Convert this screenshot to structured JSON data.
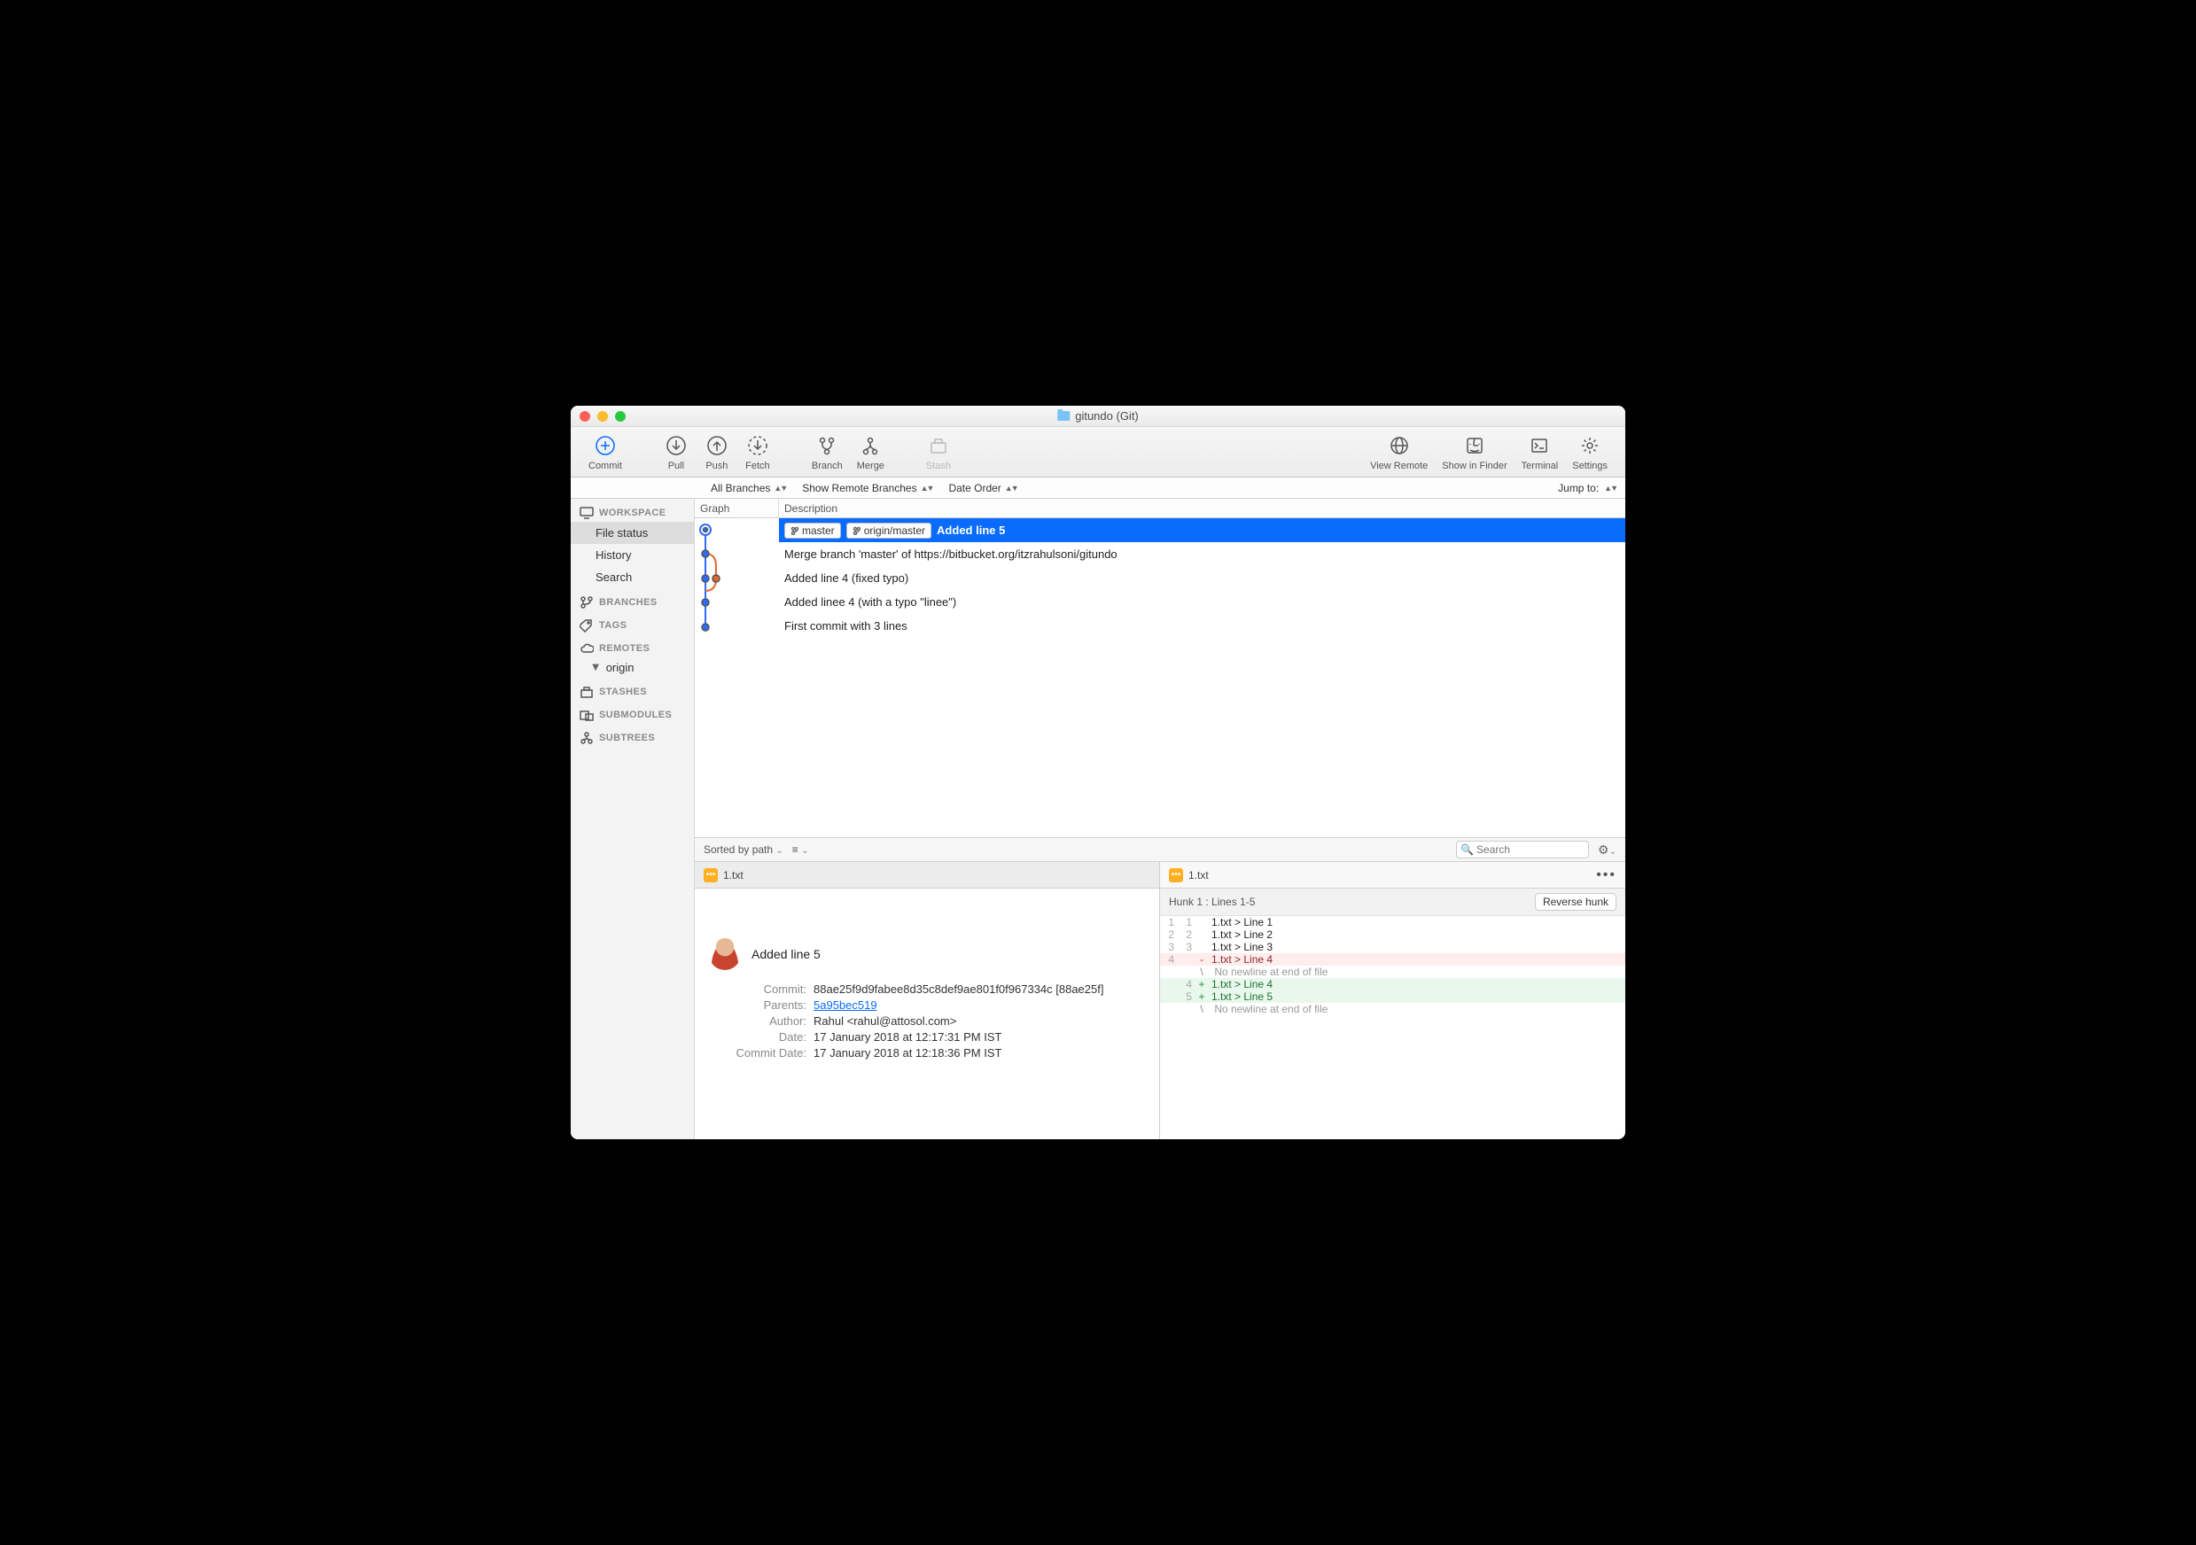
{
  "title": "gitundo (Git)",
  "toolbar": {
    "commit": "Commit",
    "pull": "Pull",
    "push": "Push",
    "fetch": "Fetch",
    "branch": "Branch",
    "merge": "Merge",
    "stash": "Stash",
    "view_remote": "View Remote",
    "show_in_finder": "Show in Finder",
    "terminal": "Terminal",
    "settings": "Settings"
  },
  "filter": {
    "branches": "All Branches",
    "remote": "Show Remote Branches",
    "order": "Date Order",
    "jump_label": "Jump to:"
  },
  "columns": {
    "graph": "Graph",
    "description": "Description"
  },
  "sidebar": {
    "workspace": "WORKSPACE",
    "file_status": "File status",
    "history": "History",
    "search": "Search",
    "branches": "BRANCHES",
    "tags": "TAGS",
    "remotes": "REMOTES",
    "origin": "origin",
    "stashes": "STASHES",
    "submodules": "SUBMODULES",
    "subtrees": "SUBTREES"
  },
  "commits": [
    {
      "tags": [
        "master",
        "origin/master"
      ],
      "msg": "Added line 5",
      "selected": true
    },
    {
      "tags": [],
      "msg": "Merge branch 'master' of https://bitbucket.org/itzrahulsoni/gitundo"
    },
    {
      "tags": [],
      "msg": "Added line 4 (fixed typo)"
    },
    {
      "tags": [],
      "msg": "Added linee 4 (with a typo \"linee\")"
    },
    {
      "tags": [],
      "msg": "First commit with 3 lines"
    }
  ],
  "pathbar": {
    "sort": "Sorted by path",
    "search_placeholder": "Search"
  },
  "file": {
    "name": "1.txt"
  },
  "detail": {
    "title": "Added line 5",
    "commit_label": "Commit:",
    "commit": "88ae25f9d9fabee8d35c8def9ae801f0f967334c [88ae25f]",
    "parents_label": "Parents:",
    "parents": "5a95bec519",
    "author_label": "Author:",
    "author": "Rahul <rahul@attosol.com>",
    "date_label": "Date:",
    "date": "17 January 2018 at 12:17:31 PM IST",
    "commit_date_label": "Commit Date:",
    "commit_date": "17 January 2018 at 12:18:36 PM IST"
  },
  "hunk": {
    "header": "Hunk 1 : Lines 1-5",
    "reverse": "Reverse hunk",
    "lines": [
      {
        "a": "1",
        "b": "1",
        "g": " ",
        "t": "1.txt > Line 1",
        "cls": ""
      },
      {
        "a": "2",
        "b": "2",
        "g": " ",
        "t": "1.txt > Line 2",
        "cls": ""
      },
      {
        "a": "3",
        "b": "3",
        "g": " ",
        "t": "1.txt > Line 3",
        "cls": ""
      },
      {
        "a": "4",
        "b": "",
        "g": "-",
        "t": "1.txt > Line 4",
        "cls": "row-del"
      },
      {
        "a": "",
        "b": "",
        "g": "\\",
        "t": " No newline at end of file",
        "cls": "row-meta"
      },
      {
        "a": "",
        "b": "4",
        "g": "+",
        "t": "1.txt > Line 4",
        "cls": "row-add"
      },
      {
        "a": "",
        "b": "5",
        "g": "+",
        "t": "1.txt > Line 5",
        "cls": "row-add"
      },
      {
        "a": "",
        "b": "",
        "g": "\\",
        "t": " No newline at end of file",
        "cls": "row-meta"
      }
    ]
  }
}
